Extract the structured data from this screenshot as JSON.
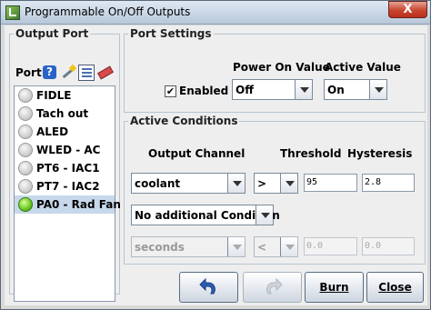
{
  "window": {
    "title": "Programmable On/Off Outputs",
    "close_symbol": "X"
  },
  "output_port": {
    "legend": "Output Port",
    "port_label": "Port",
    "help_symbol": "?",
    "items": [
      {
        "name": "FIDLE",
        "active": false,
        "selected": false
      },
      {
        "name": "Tach out",
        "active": false,
        "selected": false
      },
      {
        "name": "ALED",
        "active": false,
        "selected": false
      },
      {
        "name": "WLED - AC",
        "active": false,
        "selected": false
      },
      {
        "name": "PT6 - IAC1",
        "active": false,
        "selected": false
      },
      {
        "name": "PT7 - IAC2",
        "active": false,
        "selected": false
      },
      {
        "name": "PA0 - Rad Fan",
        "active": true,
        "selected": true
      }
    ]
  },
  "port_settings": {
    "legend": "Port Settings",
    "enabled_label": "Enabled",
    "enabled_checked": true,
    "power_on_label": "Power On Value",
    "power_on_value": "Off",
    "active_value_label": "Active Value",
    "active_value": "On"
  },
  "active_conditions": {
    "legend": "Active Conditions",
    "output_channel_label": "Output Channel",
    "threshold_label": "Threshold",
    "hysteresis_label": "Hysteresis",
    "row1": {
      "channel": "coolant",
      "operator": ">",
      "threshold": "95",
      "hysteresis": "2.8"
    },
    "additional_condition": "No additional Condition",
    "row2": {
      "channel": "seconds",
      "operator": "<",
      "threshold": "0.0",
      "hysteresis": "0.0"
    }
  },
  "buttons": {
    "burn": "Burn",
    "close": "Close"
  },
  "colors": {
    "selected_row": "#c7d8ea",
    "led_on": "#67c51c",
    "close_button": "#c9452f"
  }
}
